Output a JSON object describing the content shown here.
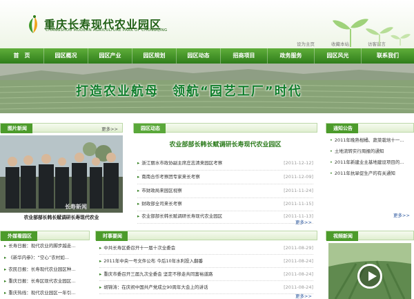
{
  "header": {
    "title_cn": "重庆长寿现代农业园区",
    "title_en": "CHANGSHOU MODERN AGRICULTURE PARK OF CHONGQING",
    "links": [
      "设为主页",
      "收藏本站",
      "访客留言"
    ]
  },
  "nav": {
    "items": [
      "首　页",
      "园区概况",
      "园区产业",
      "园区规划",
      "园区动态",
      "招商项目",
      "政务服务",
      "园区风光",
      "联系我们"
    ]
  },
  "banner": {
    "slogan": "打造农业航母　领航“园艺工厂”时代"
  },
  "photo_news": {
    "tag": "图片新闻",
    "more": "更多>>",
    "caption": "农业部部长韩长赋调研长寿现代农业"
  },
  "park_news": {
    "tag": "园区动态",
    "headline": "农业部部长韩长赋调研长寿现代农业园区",
    "items": [
      {
        "title": "浙江丽水市政协副主席庄志清来园区考察",
        "date": "[2011-12-12]"
      },
      {
        "title": "南南合作考察团专家来长考察",
        "date": "[2011-12-09]"
      },
      {
        "title": "市财政局来园区视察",
        "date": "[2011-11-24]"
      },
      {
        "title": "财政部全司来长考察",
        "date": "[2011-11-15]"
      },
      {
        "title": "农业部部长韩长赋调研长寿现代农业园区",
        "date": "[2011-11-13]"
      }
    ],
    "more": "更多>>"
  },
  "notice": {
    "tag": "通知公告",
    "items": [
      "2011年晚熟柑橘、蔬菜栽培十一...",
      "土地流转实行周报的通知",
      "2011年新建业主基地建设项目的...",
      "2011年抗旱促生产的有关通知"
    ],
    "more": "更多>>"
  },
  "external_news": {
    "tag": "外媒看园区",
    "items": [
      "长寿日报：现代农业的脚步越走...",
      "《新华内参》：“空心”农村如...",
      "农民日报：长寿现代农业园区种...",
      "重庆日报：长寿区现代农业园区...",
      "重庆热线：现代农业园区一年引..."
    ]
  },
  "current_news": {
    "tag": "时事要闻",
    "items": [
      {
        "title": "中共长寿区委召开十一届十次全委会",
        "date": "[2011-08-29]"
      },
      {
        "title": "2011年中央一号文件公布 今后10年水利投入翻番",
        "date": "[2011-08-24]"
      },
      {
        "title": "重庆市委召开三届九次全委会 坚定不移走共同富裕道路",
        "date": "[2011-08-24]"
      },
      {
        "title": "胡锦涛：在庆祝中国共产党成立90周年大会上的讲话",
        "date": "[2011-08-24]"
      }
    ],
    "more": "更多>>"
  },
  "video_news": {
    "tag": "视频新闻"
  },
  "colors": {
    "primary_green": "#2f7d1b",
    "accent_green": "#4c9b2b",
    "slogan_green": "#0f7d2a"
  }
}
